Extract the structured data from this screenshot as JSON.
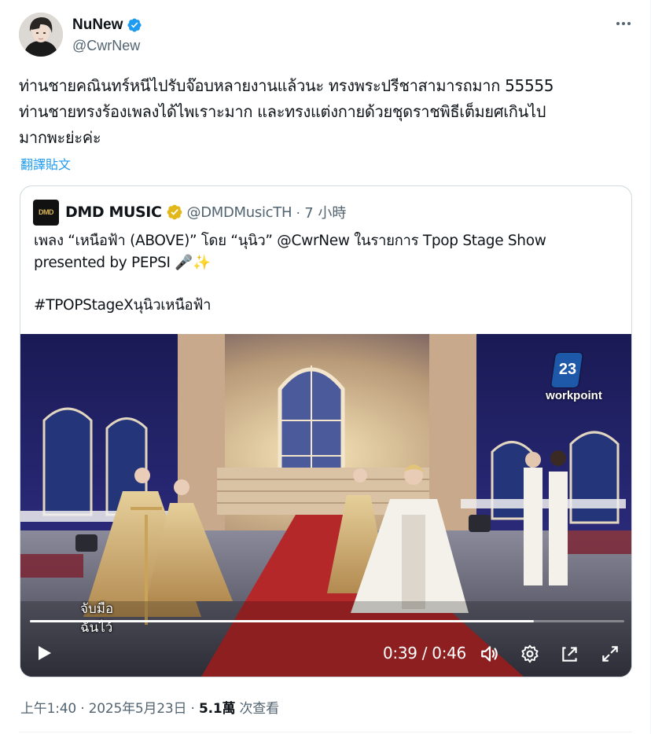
{
  "author": {
    "display_name": "NuNew",
    "handle": "@CwrNew",
    "verified": true,
    "verified_color": "#1d9bf0"
  },
  "tweet": {
    "lines": [
      "ท่านชายคณินทร์หนีไปรับจ๊อบหลายงานแล้วนะ ทรงพระปรีชาสามารถมาก 55555",
      "ท่านชายทรงร้องเพลงได้ไพเราะมาก และทรงแต่งกายด้วยชุดราชพิธีเต็มยศเกินไป",
      "มากพะย่ะค่ะ"
    ],
    "translate_label": "翻譯貼文"
  },
  "quoted": {
    "display_name": "DMD MUSIC",
    "logo_text": "DMD",
    "verified_color": "#e2b719",
    "handle": "@DMDMusicTH",
    "separator": "·",
    "time": "7 小時",
    "text_line1": "เพลง “เหนือฟ้า (ABOVE)” โดย “นุนิว” @CwrNew ในรายการ Tpop Stage Show",
    "text_line2": "presented by PEPSI 🎤✨",
    "hashtag": "#TPOPStageXนุนิวเหนือฟ้า"
  },
  "video": {
    "channel_number": "23",
    "channel_name": "workpoint",
    "caption_line1": "จับมือ",
    "caption_line2": "ฉันไว้",
    "current_time": "0:39",
    "duration": "0:46",
    "timecode": "0:39 / 0:46",
    "progress_fraction": 0.848
  },
  "footer": {
    "time": "上午1:40",
    "dot": " · ",
    "date": "2025年5月23日",
    "views": "5.1萬",
    "views_label": " 次查看"
  },
  "icons": [
    "verified-badge-icon",
    "more-options-icon",
    "play-icon",
    "volume-icon",
    "settings-icon",
    "pip-icon",
    "fullscreen-icon"
  ]
}
